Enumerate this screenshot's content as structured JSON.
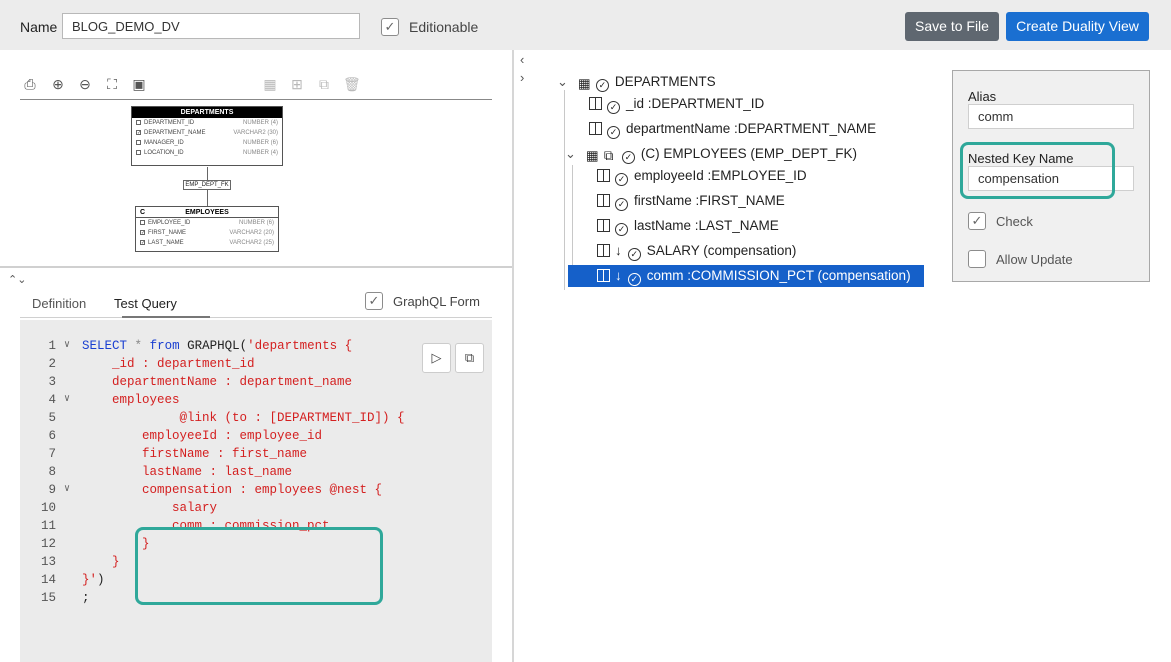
{
  "header": {
    "name_label": "Name",
    "name_value": "BLOG_DEMO_DV",
    "editionable_label": "Editionable",
    "editionable_checked": true,
    "save_label": "Save to File",
    "create_label": "Create Duality View"
  },
  "diagram": {
    "departments": {
      "title": "DEPARTMENTS",
      "rows": [
        {
          "name": "DEPARTMENT_ID",
          "type": "NUMBER (4)"
        },
        {
          "name": "DEPARTMENT_NAME",
          "type": "VARCHAR2 (30)"
        },
        {
          "name": "MANAGER_ID",
          "type": "NUMBER (6)"
        },
        {
          "name": "LOCATION_ID",
          "type": "NUMBER (4)"
        }
      ]
    },
    "fk_label": "EMP_DEPT_FK",
    "employees": {
      "marker": "C",
      "title": "EMPLOYEES",
      "rows": [
        {
          "name": "EMPLOYEE_ID",
          "type": "NUMBER (6)"
        },
        {
          "name": "FIRST_NAME",
          "type": "VARCHAR2 (20)"
        },
        {
          "name": "LAST_NAME",
          "type": "VARCHAR2 (25)"
        }
      ]
    }
  },
  "tabs": {
    "definition": "Definition",
    "test_query": "Test Query",
    "graphql_form": "GraphQL Form"
  },
  "editor": {
    "line_numbers": [
      "1",
      "2",
      "3",
      "4",
      "5",
      "6",
      "7",
      "8",
      "9",
      "10",
      "11",
      "12",
      "13",
      "14",
      "15"
    ],
    "lines": [
      "SELECT * from GRAPHQL('departments {",
      "    _id : department_id",
      "    departmentName : department_name",
      "    employees",
      "             @link (to : [DEPARTMENT_ID]) {",
      "        employeeId : employee_id",
      "        firstName : first_name",
      "        lastName : last_name",
      "        compensation : employees @nest {",
      "            salary",
      "            comm : commission_pct",
      "        }",
      "    }",
      "}')",
      ";"
    ]
  },
  "tree": {
    "departments": "DEPARTMENTS",
    "id": "_id :DEPARTMENT_ID",
    "department_name": "departmentName :DEPARTMENT_NAME",
    "employees": "(C) EMPLOYEES (EMP_DEPT_FK)",
    "employee_id": "employeeId :EMPLOYEE_ID",
    "first_name": "firstName :FIRST_NAME",
    "last_name": "lastName :LAST_NAME",
    "salary": "SALARY (compensation)",
    "comm": "comm :COMMISSION_PCT (compensation)"
  },
  "properties": {
    "alias_label": "Alias",
    "alias_value": "comm",
    "nested_key_label": "Nested Key Name",
    "nested_key_value": "compensation",
    "check_label": "Check",
    "check_checked": true,
    "allow_update_label": "Allow Update",
    "allow_update_checked": false
  },
  "colors": {
    "accent_blue": "#1a6fd1",
    "selection_blue": "#1560c9",
    "highlight_teal": "#2fa89a",
    "code_red": "#d42020",
    "code_keyword": "#1a3fd1"
  }
}
